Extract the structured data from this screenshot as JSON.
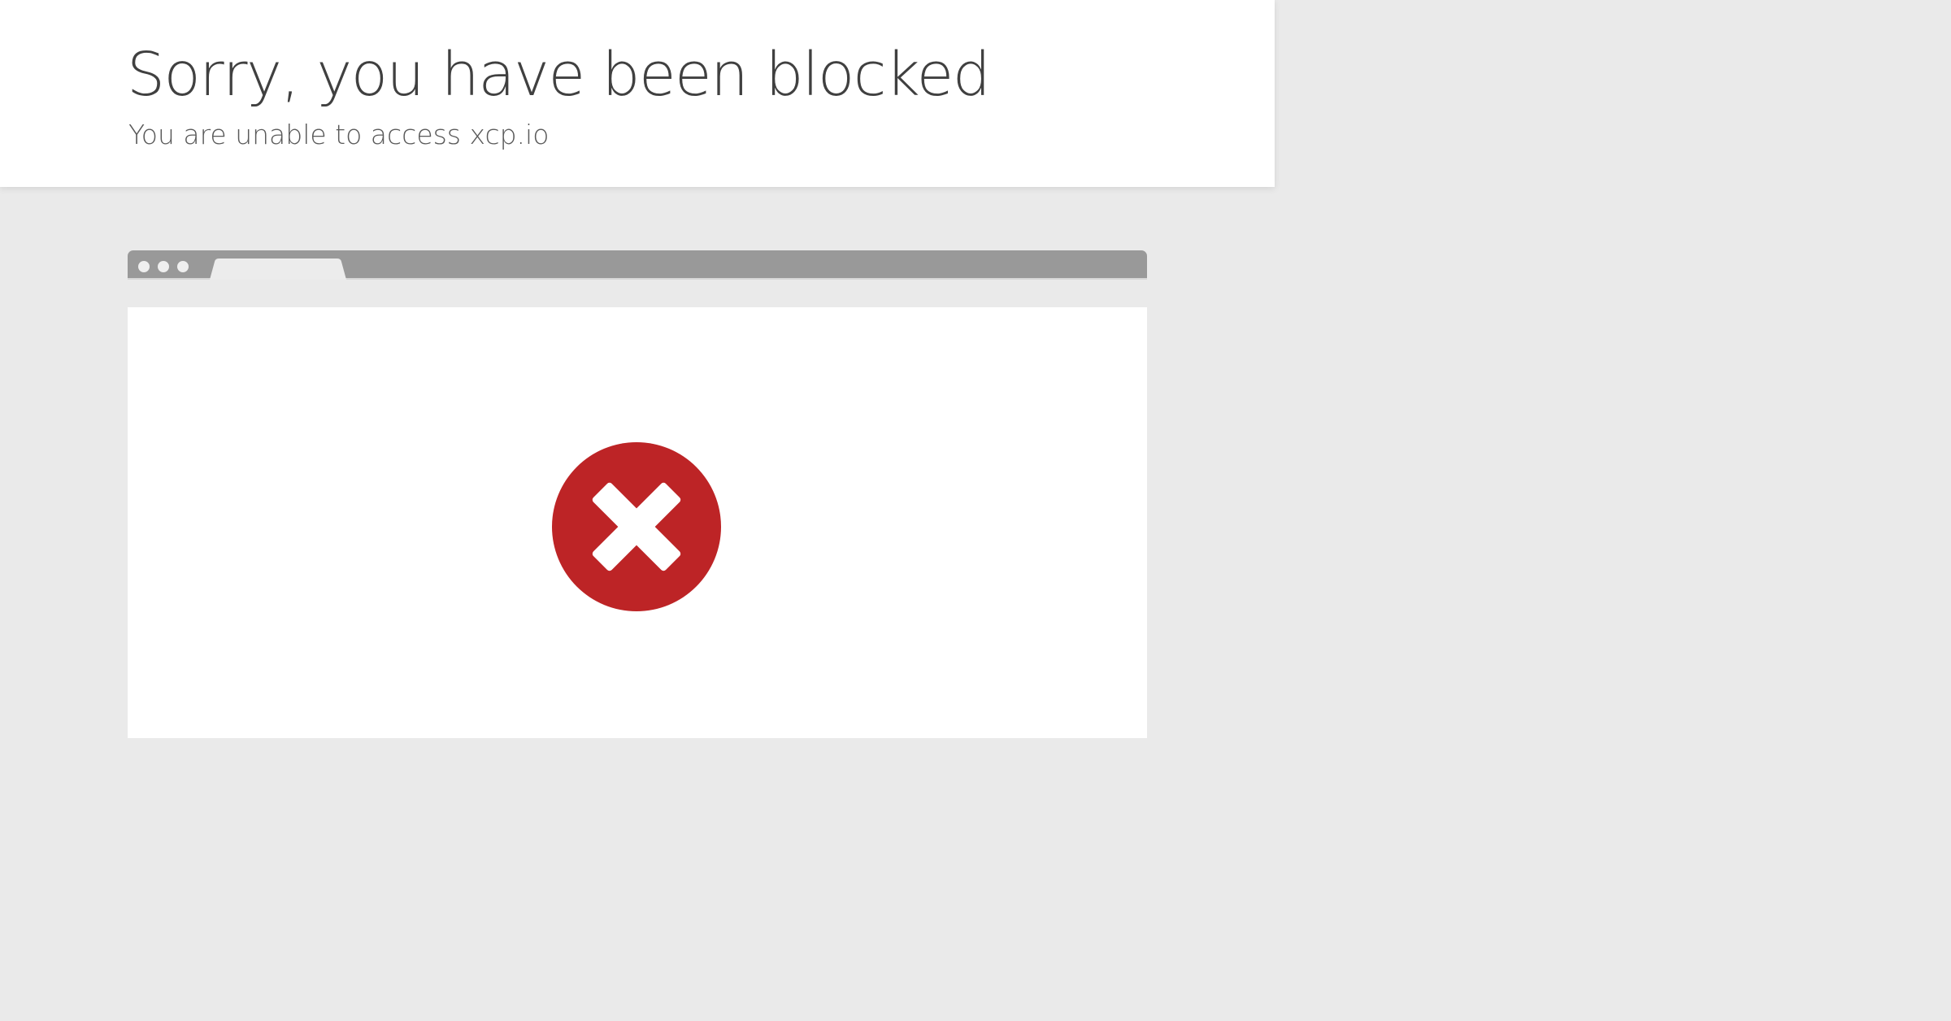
{
  "header": {
    "title": "Sorry, you have been blocked",
    "subtitle": "You are unable to access xcp.io"
  },
  "browser_illustration": {
    "icon": "error-x-circle-icon",
    "colors": {
      "error_red": "#bd2426",
      "tab_bar": "#999999",
      "background": "#eaeaea"
    }
  }
}
